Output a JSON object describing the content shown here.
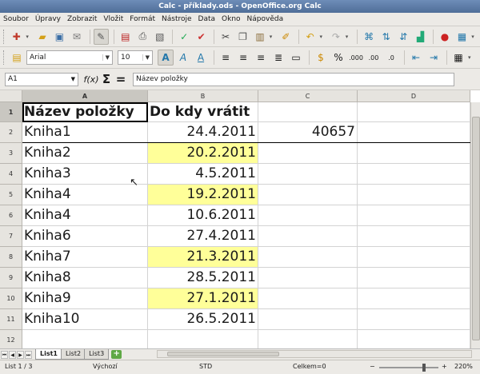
{
  "window": {
    "title": "Calc - příklady.ods - OpenOffice.org Calc"
  },
  "menu": [
    "Soubor",
    "Úpravy",
    "Zobrazit",
    "Vložit",
    "Formát",
    "Nástroje",
    "Data",
    "Okno",
    "Nápověda"
  ],
  "font": {
    "name": "Arial",
    "size": "10"
  },
  "formula": {
    "cell_ref": "A1",
    "content": "Název položky"
  },
  "columns": [
    "A",
    "B",
    "C",
    "D"
  ],
  "rows": [
    "1",
    "2",
    "3",
    "4",
    "5",
    "6",
    "7",
    "8",
    "9",
    "10",
    "11",
    "12"
  ],
  "cells": {
    "A1": "Název položky",
    "B1": "Do kdy vrátit",
    "A2": "Kniha1",
    "B2": "24.4.2011",
    "C2": "40657",
    "A3": "Kniha2",
    "B3": "20.2.2011",
    "A4": "Kniha3",
    "B4": "4.5.2011",
    "A5": "Kniha4",
    "B5": "19.2.2011",
    "A6": "Kniha4",
    "B6": "10.6.2011",
    "A7": "Kniha6",
    "B7": "27.4.2011",
    "A8": "Kniha7",
    "B8": "21.3.2011",
    "A9": "Kniha8",
    "B9": "28.5.2011",
    "A10": "Kniha9",
    "B10": "27.1.2011",
    "A11": "Kniha10",
    "B11": "26.5.2011"
  },
  "highlight_color": "#ffff99",
  "sheets": [
    "List1",
    "List2",
    "List3"
  ],
  "active_sheet": "List1",
  "status": {
    "sheet": "List 1 / 3",
    "style": "Výchozí",
    "mode": "STD",
    "sum": "Celkem=0",
    "zoom": "220%"
  }
}
